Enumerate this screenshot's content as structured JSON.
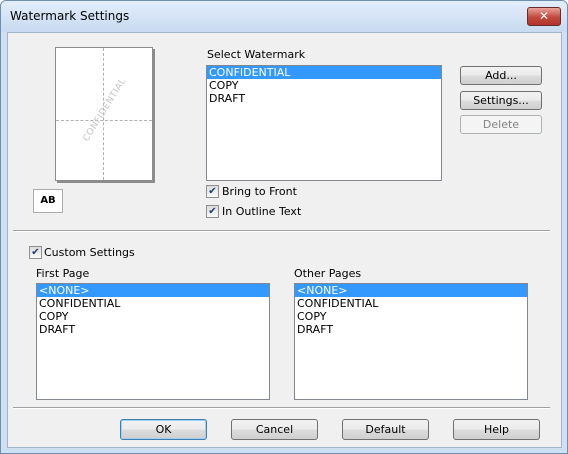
{
  "window": {
    "title": "Watermark Settings",
    "close_glyph": "✕"
  },
  "preview": {
    "watermark_text": "CONFIDENTIAL",
    "ab_label": "AB"
  },
  "select_watermark": {
    "label": "Select Watermark",
    "items": [
      "CONFIDENTIAL",
      "COPY",
      "DRAFT"
    ],
    "selected": "CONFIDENTIAL"
  },
  "buttons": {
    "add": "Add...",
    "settings": "Settings...",
    "delete": "Delete"
  },
  "options": {
    "bring_to_front": {
      "label": "Bring to Front",
      "checked": true
    },
    "in_outline_text": {
      "label": "In Outline Text",
      "checked": true
    }
  },
  "custom_settings": {
    "label": "Custom Settings",
    "checked": true
  },
  "first_page": {
    "label": "First Page",
    "items": [
      "<NONE>",
      "CONFIDENTIAL",
      "COPY",
      "DRAFT"
    ],
    "selected": "<NONE>"
  },
  "other_pages": {
    "label": "Other Pages",
    "items": [
      "<NONE>",
      "CONFIDENTIAL",
      "COPY",
      "DRAFT"
    ],
    "selected": "<NONE>"
  },
  "footer": {
    "ok": "OK",
    "cancel": "Cancel",
    "default": "Default",
    "help": "Help"
  },
  "colors": {
    "selection": "#3399ff",
    "frame": "#cfe0f3"
  }
}
